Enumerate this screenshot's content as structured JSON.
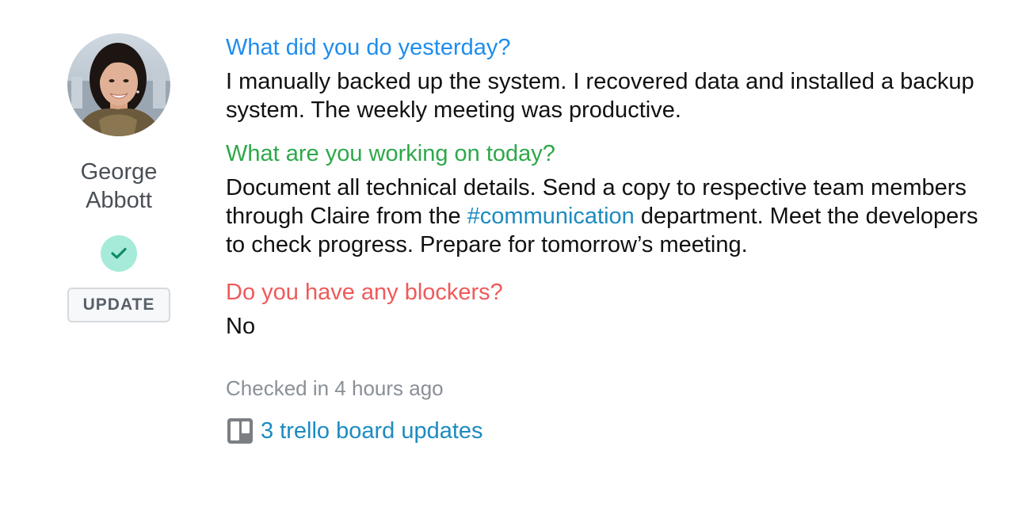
{
  "user": {
    "name": "George Abbott",
    "update_label": "UPDATE",
    "status_icon": "check-icon",
    "colors": {
      "badge_bg": "#a6ebd9",
      "check": "#0e8a6a"
    }
  },
  "standup": {
    "q1": {
      "question": "What did you do yesterday?",
      "answer": "I manually backed up the system. I recovered data and installed a backup system. The weekly meeting was productive.",
      "color": "#1f8ded"
    },
    "q2": {
      "question": "What are you working on today?",
      "answer_before": "Document all technical details. Send a copy to respective team members through Claire from the ",
      "hashtag": "#communication",
      "answer_after": " department. Meet the developers to check progress. Prepare for tomorrow’s meeting.",
      "color": "#2ea84a"
    },
    "q3": {
      "question": "Do you have any blockers?",
      "answer": "No",
      "color": "#ef5a5a"
    }
  },
  "footer": {
    "checked_in": "Checked in 4 hours ago",
    "trello_link": "3 trello board updates",
    "trello_icon": "trello-icon"
  }
}
